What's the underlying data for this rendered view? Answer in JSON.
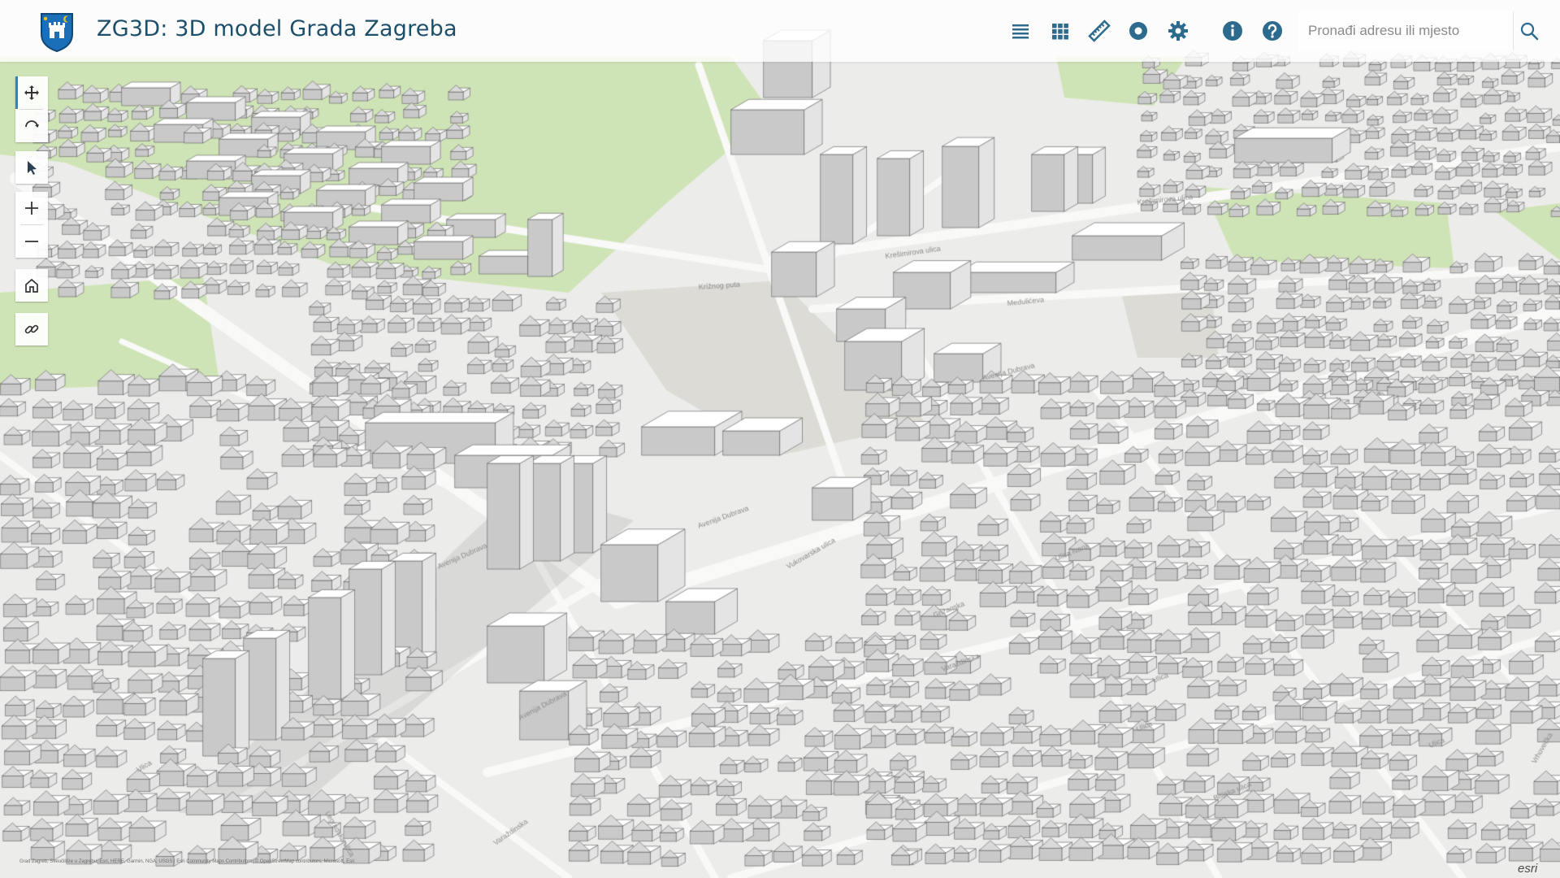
{
  "header": {
    "title": "ZG3D: 3D model Grada Zagreba",
    "logo_icon": "zagreb-coat-of-arms-icon",
    "accent_color": "#1d4f6b",
    "tools": [
      {
        "name": "layer-list-icon",
        "label": "Layer list"
      },
      {
        "name": "basemap-gallery-icon",
        "label": "Basemap gallery"
      },
      {
        "name": "measure-ruler-icon",
        "label": "Measurement"
      },
      {
        "name": "daylight-icon",
        "label": "Daylight"
      },
      {
        "name": "settings-gear-icon",
        "label": "Settings"
      },
      {
        "name": "info-icon",
        "label": "About"
      },
      {
        "name": "help-icon",
        "label": "Help"
      }
    ]
  },
  "search": {
    "placeholder": "Pronađi adresu ili mjesto",
    "value": "",
    "button_icon": "search-icon"
  },
  "navigation": {
    "groups": [
      [
        "pan-icon",
        "rotate-icon"
      ],
      [
        "select-pointer-icon"
      ],
      [
        "zoom-in-icon",
        "zoom-out-icon"
      ],
      [
        "home-icon"
      ],
      [
        "link-icon"
      ]
    ]
  },
  "map": {
    "street_labels": [
      "Krešimirova ulica",
      "Krešimirova ulica",
      "Medulićeva",
      "Krížnog puta",
      "Avenija Dubrava",
      "Avenija Dubrava",
      "Avenija Dubrava",
      "Avenija Dubrava",
      "Vukovarska ulica",
      "Varaždinska",
      "Grižanska",
      "Ulica Ivana",
      "Ulica",
      "Bilijska ulica",
      "Vrhovečka",
      "Ulica",
      "Ulica",
      "Legradska ulica",
      "Ulica",
      "Varaždinska"
    ],
    "colors": {
      "ground": "#ecedea",
      "grass": "#cfe4b6",
      "plaza": "#dcdbd6",
      "road": "#f9f9f8",
      "building_top": "#ffffff",
      "building_left": "#c9c9c9",
      "building_right": "#e4e4e4"
    }
  },
  "footer": {
    "attribution": "Grad Zagreb; Sveučilište u Zagrebu; Esri, HERE, Garmin, NGA, USGS | Esri Community Maps Contributors, © OpenStreetMap contributors, Microsoft, Esri",
    "esri_logo": "esri"
  }
}
